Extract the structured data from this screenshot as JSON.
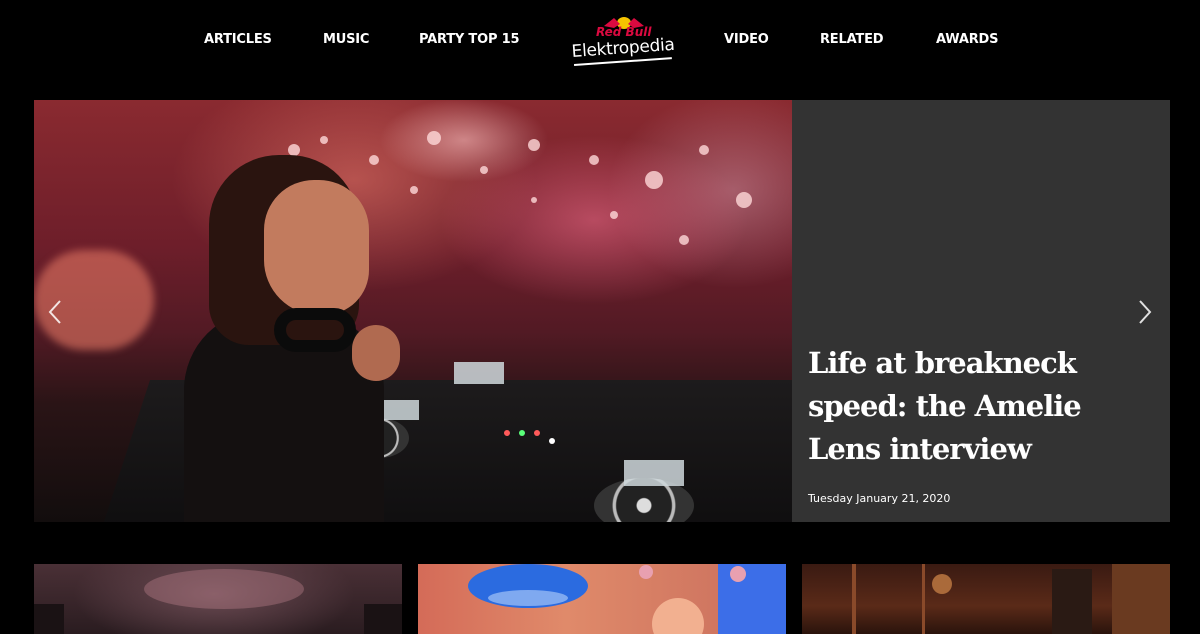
{
  "nav": {
    "left_items": [
      "ARTICLES",
      "MUSIC",
      "PARTY TOP 15"
    ],
    "right_items": [
      "VIDEO",
      "RELATED",
      "AWARDS"
    ],
    "logo": {
      "brand": "Red Bull",
      "wordmark": "Elektropedia"
    }
  },
  "hero": {
    "title": "Life at breakneck speed: the Amelie Lens interview",
    "date": "Tuesday January 21, 2020",
    "prev_icon": "chevron-left-icon",
    "next_icon": "chevron-right-icon"
  },
  "colors": {
    "background": "#000000",
    "panel": "#333333",
    "brand_red": "#db0a40",
    "text": "#ffffff"
  }
}
